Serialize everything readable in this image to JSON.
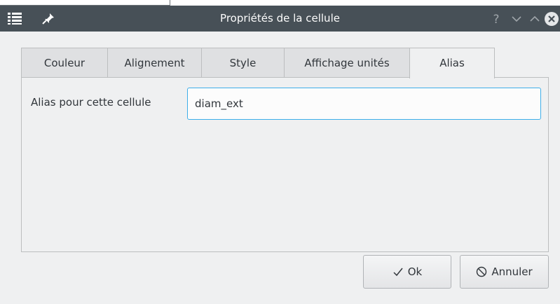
{
  "window": {
    "title": "Propriétés de la cellule"
  },
  "tabs": [
    {
      "label": "Couleur",
      "active": false
    },
    {
      "label": "Alignement",
      "active": false
    },
    {
      "label": "Style",
      "active": false
    },
    {
      "label": "Affichage unités",
      "active": false
    },
    {
      "label": "Alias",
      "active": true
    }
  ],
  "alias": {
    "label": "Alias pour cette cellule",
    "value": "diam_ext"
  },
  "buttons": {
    "ok_label": "Ok",
    "cancel_label": "Annuler"
  },
  "icons": {
    "menu": "window-menu-icon",
    "pin": "pin-icon",
    "help": "help-icon",
    "minimize": "chevron-down-icon",
    "maximize": "chevron-up-icon",
    "close": "close-icon",
    "ok": "checkmark-icon",
    "cancel": "cancel-icon"
  },
  "colors": {
    "titlebar": "#475057",
    "window_bg": "#eff0f1",
    "focus": "#3daee9"
  }
}
